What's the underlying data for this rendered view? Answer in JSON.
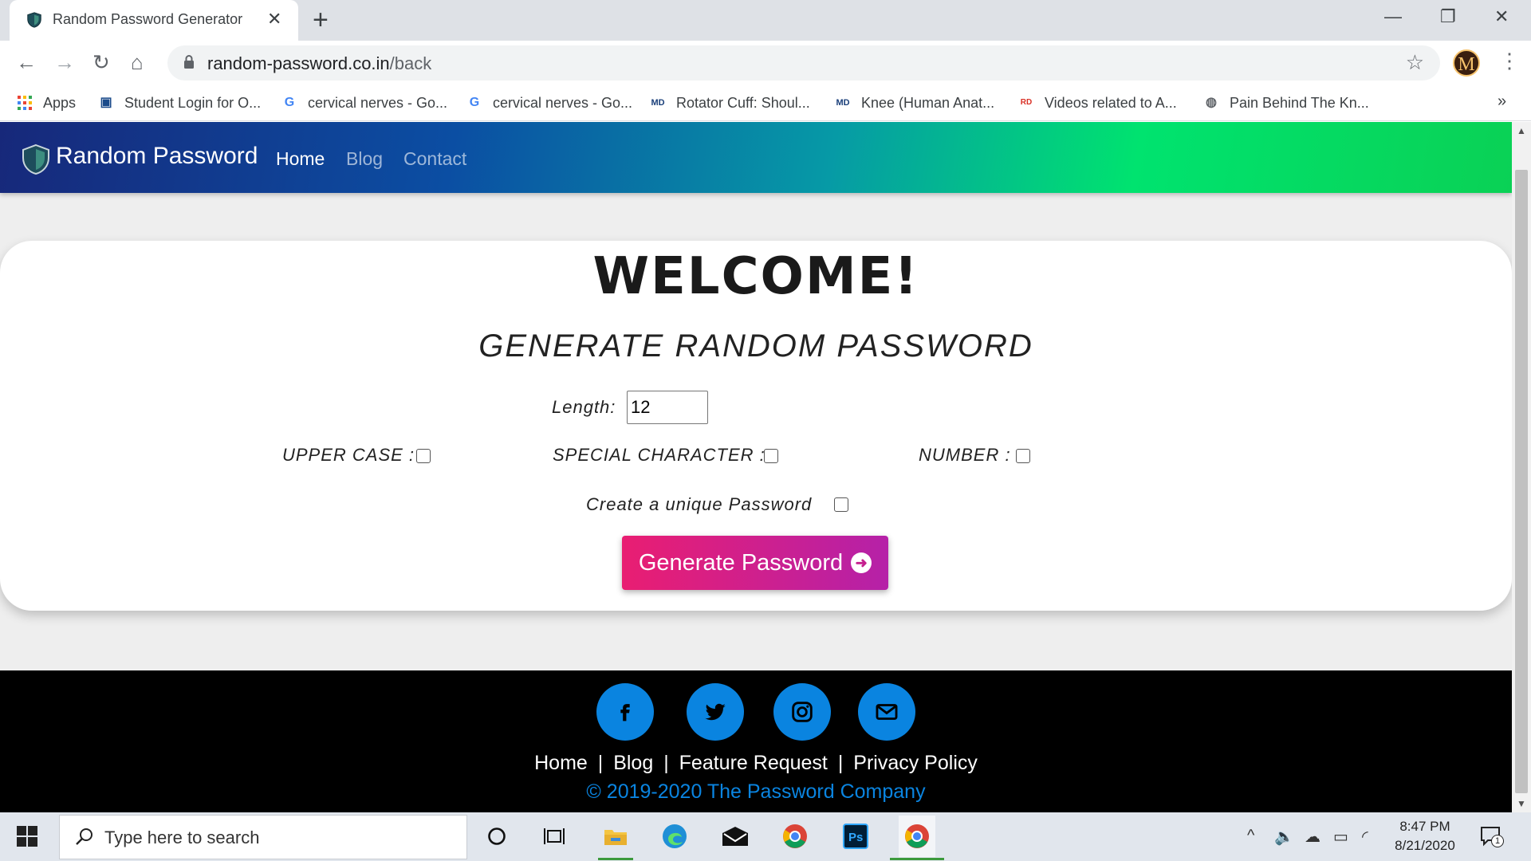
{
  "browser": {
    "tab_title": "Random Password Generator",
    "new_tab_icon": "+",
    "url_domain": "random-password.co.in",
    "url_path": "/back",
    "profile_initial": "M",
    "bookmarks": [
      {
        "label": "Apps",
        "icon": "apps-grid-icon"
      },
      {
        "label": "Student Login for O...",
        "icon": "student-portal-icon"
      },
      {
        "label": "cervical nerves - Go...",
        "icon": "google-icon"
      },
      {
        "label": "cervical nerves - Go...",
        "icon": "google-icon"
      },
      {
        "label": "Rotator Cuff: Shoul...",
        "icon": "webmd-icon"
      },
      {
        "label": "Knee (Human Anat...",
        "icon": "webmd-icon"
      },
      {
        "label": "Videos related to A...",
        "icon": "rd-icon"
      },
      {
        "label": "Pain Behind The Kn...",
        "icon": "globe-icon"
      }
    ],
    "more_bookmarks": "»"
  },
  "site": {
    "brand": "Random Password",
    "nav": [
      {
        "label": "Home",
        "active": true
      },
      {
        "label": "Blog",
        "active": false
      },
      {
        "label": "Contact",
        "active": false
      }
    ]
  },
  "generator": {
    "welcome": "WELCOME!",
    "subtitle": "GENERATE RANDOM PASSWORD",
    "length_label": "Length:",
    "length_value": "12",
    "upper_label": "UPPER CASE :",
    "special_label": "SPECIAL CHARACTER :",
    "number_label": "NUMBER :",
    "unique_label": "Create a unique Password",
    "button_label": "Generate Password",
    "checkboxes": {
      "upper": false,
      "special": false,
      "number": false,
      "unique": false
    }
  },
  "footer": {
    "social": [
      "facebook-icon",
      "twitter-icon",
      "instagram-icon",
      "email-icon"
    ],
    "links": [
      "Home",
      "Blog",
      "Feature Request",
      "Privacy Policy"
    ],
    "separator": "|",
    "copyright": "© 2019-2020 The Password Company"
  },
  "taskbar": {
    "search_placeholder": "Type here to search",
    "time": "8:47 PM",
    "date": "8/21/2020",
    "notification_count": "1"
  },
  "colors": {
    "accent_blue": "#0a84e0",
    "button_start": "#e91e72",
    "button_end": "#b521a8"
  }
}
